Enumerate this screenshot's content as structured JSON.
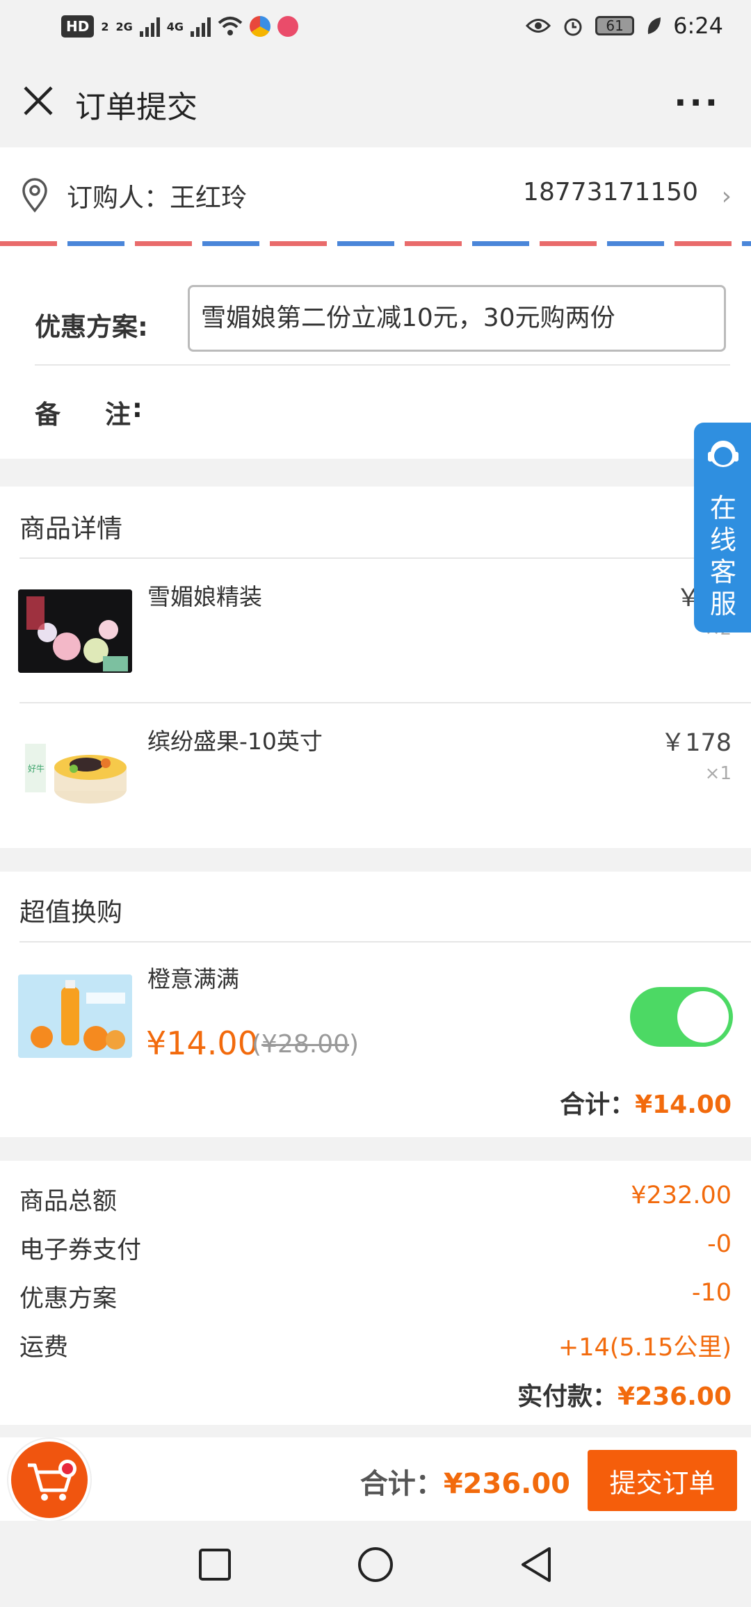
{
  "status_bar": {
    "hd": "HD",
    "hd_sub": "2",
    "net1": "2G",
    "net2": "4G",
    "battery": "61",
    "time": "6:24"
  },
  "header": {
    "title": "订单提交",
    "more": "···"
  },
  "address": {
    "buyer": "订购人：王红玲",
    "phone": "18773171150",
    "chevron": "›"
  },
  "promo": {
    "label": "优惠方案:",
    "value": "雪媚娘第二份立减10元，30元购两份",
    "remark_label": "备注",
    "remark_colon": ":"
  },
  "products": {
    "title": "商品详情",
    "items": [
      {
        "name": "雪媚娘精装",
        "price": "￥20",
        "qty": "×2"
      },
      {
        "name": "缤纷盛果-10英寸",
        "price": "￥178",
        "qty": "×1"
      }
    ]
  },
  "exchange": {
    "title": "超值换购",
    "name": "橙意满满",
    "price": "¥14.00",
    "orig_open": "(",
    "orig_price": "¥28.00",
    "orig_close": ")",
    "enabled": true,
    "total_label": "合计：",
    "total_value": "¥14.00"
  },
  "summary": {
    "rows": [
      {
        "label": "商品总额",
        "value": "¥232.00"
      },
      {
        "label": "电子券支付",
        "value": "-0"
      },
      {
        "label": "优惠方案",
        "value": "-10"
      },
      {
        "label": "运费",
        "value": "+14(5.15公里)"
      }
    ],
    "final_label": "实付款：",
    "final_value": "¥236.00"
  },
  "bottom": {
    "total_label": "合计：",
    "total_value": "¥236.00",
    "submit": "提交订单"
  },
  "service": {
    "text": "在线客服"
  },
  "colors": {
    "accent": "#f26a0c",
    "toggle_on": "#4cd964",
    "service_blue": "#2f8fe0"
  }
}
